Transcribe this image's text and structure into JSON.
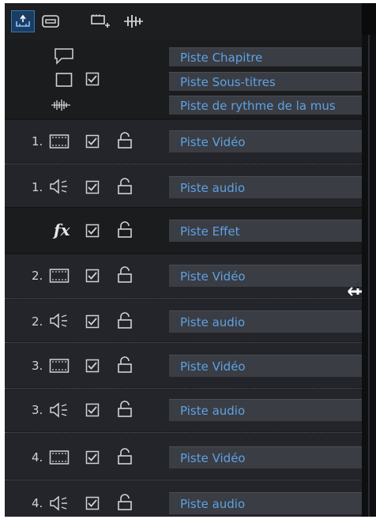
{
  "toolbar": {
    "buttons": [
      {
        "name": "track-height-icon"
      },
      {
        "name": "track-view-icon"
      },
      {
        "name": "add-track-icon"
      },
      {
        "name": "beat-marker-icon"
      }
    ]
  },
  "tracks": [
    {
      "label": "Piste Chapitre"
    },
    {
      "label": "Piste Sous-titres"
    },
    {
      "label": "Piste de rythme de la mus"
    },
    {
      "number": "1.",
      "label": "Piste Vidéo"
    },
    {
      "number": "1.",
      "label": "Piste audio"
    },
    {
      "fx": "fx",
      "label": "Piste Effet"
    },
    {
      "number": "2.",
      "label": "Piste Vidéo"
    },
    {
      "number": "2.",
      "label": "Piste audio"
    },
    {
      "number": "3.",
      "label": "Piste Vidéo"
    },
    {
      "number": "3.",
      "label": "Piste audio"
    },
    {
      "number": "4.",
      "label": "Piste Vidéo"
    },
    {
      "number": "4.",
      "label": "Piste audio"
    }
  ],
  "colors": {
    "label_text": "#5ea1e5",
    "label_bg": "#3a3d43",
    "active_button": "#1a3d63",
    "panel_bg": "#1b1c1e"
  }
}
